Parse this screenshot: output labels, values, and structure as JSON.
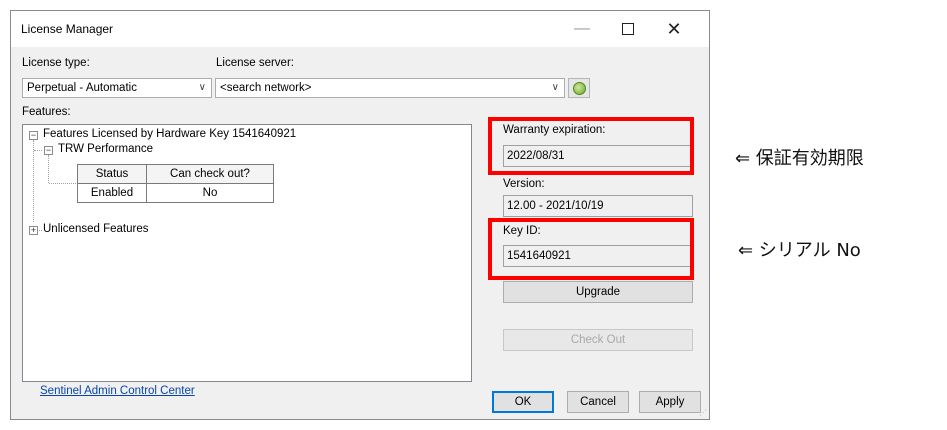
{
  "window": {
    "title": "License Manager"
  },
  "license_type": {
    "label": "License type:",
    "value": "Perpetual - Automatic"
  },
  "license_server": {
    "label": "License server:",
    "value": "<search network>"
  },
  "features": {
    "label": "Features:",
    "licensed_node": "Features Licensed by Hardware Key 1541640921",
    "product_node": "TRW Performance",
    "table": {
      "headers": [
        "Status",
        "Can check out?"
      ],
      "rows": [
        [
          "Enabled",
          "No"
        ]
      ]
    },
    "unlicensed_node": "Unlicensed Features"
  },
  "warranty": {
    "label": "Warranty expiration:",
    "value": "2022/08/31"
  },
  "version": {
    "label": "Version:",
    "value": "12.00 - 2021/10/19"
  },
  "key_id": {
    "label": "Key ID:",
    "value": "1541640921"
  },
  "buttons": {
    "upgrade": "Upgrade",
    "check_out": "Check Out",
    "ok": "OK",
    "cancel": "Cancel",
    "apply": "Apply"
  },
  "link": "Sentinel Admin Control Center",
  "annotations": {
    "warranty": "⇐ 保証有効期限",
    "serial": "⇐ シリアル No"
  },
  "colors": {
    "highlight": "#ff0000",
    "link": "#0645ad",
    "accent": "#0078d7"
  }
}
